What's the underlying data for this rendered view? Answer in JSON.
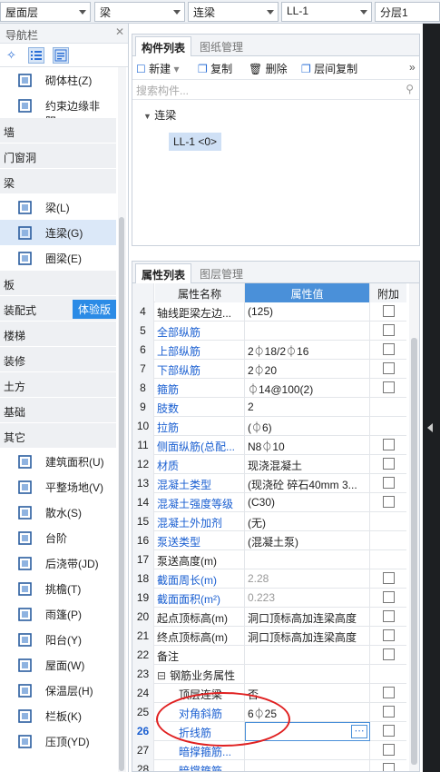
{
  "topbar": {
    "floor": "屋面层",
    "type": "梁",
    "subtype": "连梁",
    "member": "LL-1",
    "layer": "分层1"
  },
  "nav": {
    "title": "导航栏",
    "items": [
      {
        "kind": "item",
        "label": "砌体柱(Z)",
        "icon": "masonry-column-icon"
      },
      {
        "kind": "item",
        "label": "约束边缘非阴...",
        "icon": "constraint-edge-icon"
      },
      {
        "kind": "cat",
        "label": "墙"
      },
      {
        "kind": "cat",
        "label": "门窗洞"
      },
      {
        "kind": "cat",
        "label": "梁"
      },
      {
        "kind": "item",
        "label": "梁(L)",
        "icon": "beam-icon"
      },
      {
        "kind": "item",
        "label": "连梁(G)",
        "icon": "coupling-beam-icon",
        "selected": true
      },
      {
        "kind": "item",
        "label": "圈梁(E)",
        "icon": "ring-beam-icon"
      },
      {
        "kind": "cat",
        "label": "板"
      },
      {
        "kind": "cat",
        "label": "装配式",
        "badge": "体验版"
      },
      {
        "kind": "cat",
        "label": "楼梯"
      },
      {
        "kind": "cat",
        "label": "装修"
      },
      {
        "kind": "cat",
        "label": "土方"
      },
      {
        "kind": "cat",
        "label": "基础"
      },
      {
        "kind": "cat",
        "label": "其它"
      },
      {
        "kind": "item",
        "label": "建筑面积(U)",
        "icon": "building-area-icon"
      },
      {
        "kind": "item",
        "label": "平整场地(V)",
        "icon": "site-leveling-icon"
      },
      {
        "kind": "item",
        "label": "散水(S)",
        "icon": "apron-icon"
      },
      {
        "kind": "item",
        "label": "台阶",
        "icon": "steps-icon"
      },
      {
        "kind": "item",
        "label": "后浇带(JD)",
        "icon": "post-pour-strip-icon"
      },
      {
        "kind": "item",
        "label": "挑檐(T)",
        "icon": "cornice-icon"
      },
      {
        "kind": "item",
        "label": "雨篷(P)",
        "icon": "canopy-icon"
      },
      {
        "kind": "item",
        "label": "阳台(Y)",
        "icon": "balcony-icon"
      },
      {
        "kind": "item",
        "label": "屋面(W)",
        "icon": "roof-icon"
      },
      {
        "kind": "item",
        "label": "保温层(H)",
        "icon": "insulation-icon"
      },
      {
        "kind": "item",
        "label": "栏板(K)",
        "icon": "parapet-icon"
      },
      {
        "kind": "item",
        "label": "压顶(YD)",
        "icon": "coping-icon"
      }
    ]
  },
  "comp": {
    "tab1": "构件列表",
    "tab2": "图纸管理",
    "new": "新建",
    "copy": "复制",
    "delete": "删除",
    "floorcopy": "层间复制",
    "search_placeholder": "搜索构件...",
    "root": "连梁",
    "leaf": "LL-1 <0>"
  },
  "props": {
    "tab1": "属性列表",
    "tab2": "图层管理",
    "headers": {
      "name": "属性名称",
      "value": "属性值",
      "extra": "附加"
    },
    "rows": [
      {
        "n": "4",
        "name": "轴线距梁左边...",
        "value": "(125)",
        "nc": "",
        "vc": "",
        "chk": true
      },
      {
        "n": "5",
        "name": "全部纵筋",
        "value": "",
        "nc": "blue",
        "vc": "",
        "chk": true
      },
      {
        "n": "6",
        "name": "上部纵筋",
        "value": "2⏀18/2⏀16",
        "nc": "blue",
        "vc": "",
        "chk": true
      },
      {
        "n": "7",
        "name": "下部纵筋",
        "value": "2⏀20",
        "nc": "blue",
        "vc": "",
        "chk": true
      },
      {
        "n": "8",
        "name": "箍筋",
        "value": "⏀14@100(2)",
        "nc": "blue",
        "vc": "",
        "chk": true
      },
      {
        "n": "9",
        "name": "肢数",
        "value": "2",
        "nc": "blue",
        "vc": "",
        "chk": false
      },
      {
        "n": "10",
        "name": "拉筋",
        "value": "(⏀6)",
        "nc": "blue",
        "vc": "",
        "chk": false
      },
      {
        "n": "11",
        "name": "侧面纵筋(总配...",
        "value": "N8⏀10",
        "nc": "blue",
        "vc": "",
        "chk": true
      },
      {
        "n": "12",
        "name": "材质",
        "value": "现浇混凝土",
        "nc": "blue",
        "vc": "",
        "chk": true
      },
      {
        "n": "13",
        "name": "混凝土类型",
        "value": "(现浇砼 碎石40mm 3...",
        "nc": "blue",
        "vc": "",
        "chk": true
      },
      {
        "n": "14",
        "name": "混凝土强度等级",
        "value": "(C30)",
        "nc": "blue",
        "vc": "",
        "chk": true
      },
      {
        "n": "15",
        "name": "混凝土外加剂",
        "value": "(无)",
        "nc": "blue",
        "vc": "",
        "chk": false
      },
      {
        "n": "16",
        "name": "泵送类型",
        "value": "(混凝土泵)",
        "nc": "blue",
        "vc": "",
        "chk": false
      },
      {
        "n": "17",
        "name": "泵送高度(m)",
        "value": "",
        "nc": "",
        "vc": "",
        "chk": false
      },
      {
        "n": "18",
        "name": "截面周长(m)",
        "value": "2.28",
        "nc": "blue",
        "vc": "gray",
        "chk": true
      },
      {
        "n": "19",
        "name": "截面面积(m²)",
        "value": "0.223",
        "nc": "blue",
        "vc": "gray",
        "chk": true
      },
      {
        "n": "20",
        "name": "起点顶标高(m)",
        "value": "洞口顶标高加连梁高度",
        "nc": "",
        "vc": "",
        "chk": true
      },
      {
        "n": "21",
        "name": "终点顶标高(m)",
        "value": "洞口顶标高加连梁高度",
        "nc": "",
        "vc": "",
        "chk": true
      },
      {
        "n": "22",
        "name": "备注",
        "value": "",
        "nc": "",
        "vc": "",
        "chk": true
      },
      {
        "n": "23",
        "name": "钢筋业务属性",
        "value": "",
        "nc": "",
        "vc": "",
        "chk": false,
        "group": true
      },
      {
        "n": "24",
        "name": "顶层连梁",
        "value": "否",
        "nc": "",
        "vc": "",
        "chk": true,
        "indent": true
      },
      {
        "n": "25",
        "name": "对角斜筋",
        "value": "6⏀25",
        "nc": "blue",
        "vc": "",
        "chk": true,
        "indent": true
      },
      {
        "n": "26",
        "name": "折线筋",
        "value": "",
        "nc": "blue",
        "vc": "",
        "chk": true,
        "indent": true,
        "editing": true
      },
      {
        "n": "27",
        "name": "暗撑箍筋...",
        "value": "",
        "nc": "blue",
        "vc": "",
        "chk": true,
        "indent": true
      },
      {
        "n": "28",
        "name": "暗撑箍筋...",
        "value": "",
        "nc": "blue",
        "vc": "",
        "chk": true,
        "indent": true
      }
    ]
  }
}
